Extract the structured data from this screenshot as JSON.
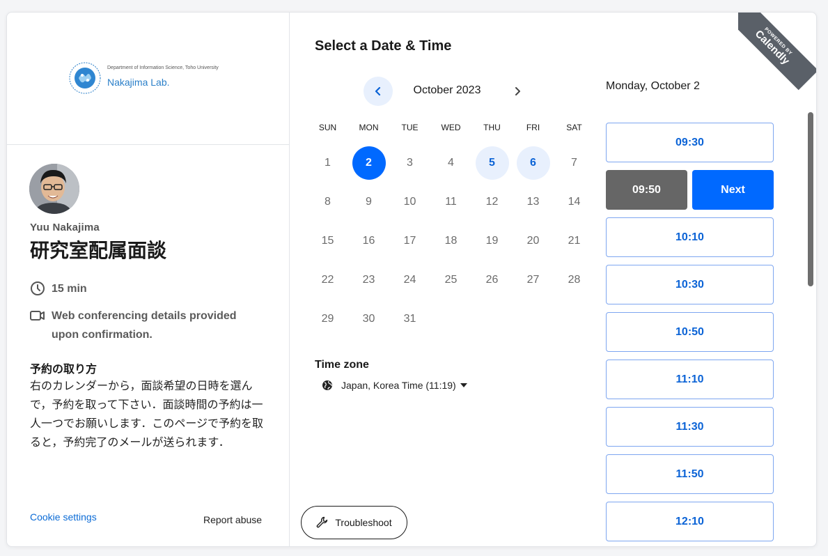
{
  "logo": {
    "department": "Department of Information Science, Toho University",
    "lab": "Nakajima Lab."
  },
  "event": {
    "host": "Yuu Nakajima",
    "title": "研究室配属面談",
    "duration": "15 min",
    "conferencing": "Web conferencing details provided upon confirmation.",
    "description_title": "予約の取り方",
    "description": "右のカレンダーから，面談希望の日時を選んで，予約を取って下さい．面談時間の予約は一人一つでお願いします．このページで予約を取ると，予約完了のメールが送られます．"
  },
  "footer": {
    "cookie": "Cookie settings",
    "report": "Report abuse"
  },
  "scheduler": {
    "title": "Select a Date & Time",
    "month": "October 2023",
    "weekdays": [
      "SUN",
      "MON",
      "TUE",
      "WED",
      "THU",
      "FRI",
      "SAT"
    ],
    "weeks": [
      [
        "1",
        "2",
        "3",
        "4",
        "5",
        "6",
        "7"
      ],
      [
        "8",
        "9",
        "10",
        "11",
        "12",
        "13",
        "14"
      ],
      [
        "15",
        "16",
        "17",
        "18",
        "19",
        "20",
        "21"
      ],
      [
        "22",
        "23",
        "24",
        "25",
        "26",
        "27",
        "28"
      ],
      [
        "29",
        "30",
        "31",
        "",
        "",
        "",
        ""
      ]
    ],
    "selected_day": "2",
    "available_days": [
      "5",
      "6"
    ],
    "timezone_label": "Time zone",
    "timezone": "Japan, Korea Time (11:19)",
    "troubleshoot": "Troubleshoot",
    "selected_date": "Monday, October 2",
    "slots": {
      "s0": "09:30",
      "selected": "09:50",
      "next": "Next",
      "s2": "10:10",
      "s3": "10:30",
      "s4": "10:50",
      "s5": "11:10",
      "s6": "11:30",
      "s7": "11:50",
      "s8": "12:10"
    }
  },
  "ribbon": {
    "small": "POWERED BY",
    "big": "Calendly"
  },
  "colors": {
    "primary": "#0069ff",
    "available_bg": "#e8f0fd",
    "selected_slot": "#666666",
    "link": "#0b6bd6"
  }
}
